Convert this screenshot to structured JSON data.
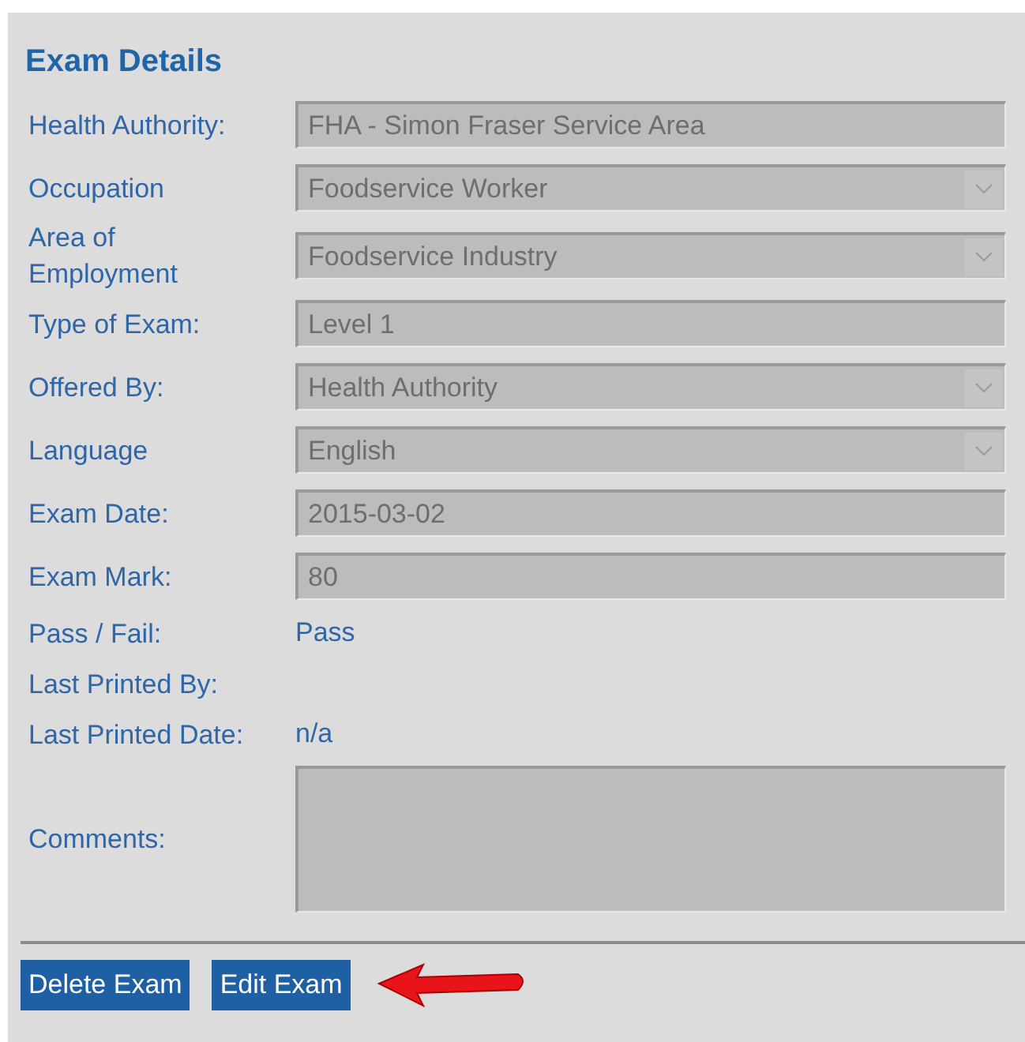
{
  "title": "Exam Details",
  "fields": [
    {
      "label": "Health Authority:",
      "kind": "text",
      "value": "FHA - Simon Fraser Service Area"
    },
    {
      "label": "Occupation",
      "kind": "select",
      "value": "Foodservice Worker"
    },
    {
      "label": "Area of Employment",
      "kind": "select",
      "value": "Foodservice Industry"
    },
    {
      "label": "Type of Exam:",
      "kind": "text",
      "value": "Level 1"
    },
    {
      "label": "Offered By:",
      "kind": "select",
      "value": "Health Authority"
    },
    {
      "label": "Language",
      "kind": "select",
      "value": "English"
    },
    {
      "label": "Exam Date:",
      "kind": "text",
      "value": "2015-03-02"
    },
    {
      "label": "Exam Mark:",
      "kind": "text",
      "value": "80"
    },
    {
      "label": "Pass / Fail:",
      "kind": "plain",
      "value": "Pass"
    },
    {
      "label": "Last Printed By:",
      "kind": "plain"
    },
    {
      "label": "Last Printed Date:",
      "kind": "plain",
      "value": "n/a"
    },
    {
      "label": "Comments:",
      "kind": "textarea"
    }
  ],
  "buttons": [
    "Delete Exam",
    "Edit Exam"
  ]
}
